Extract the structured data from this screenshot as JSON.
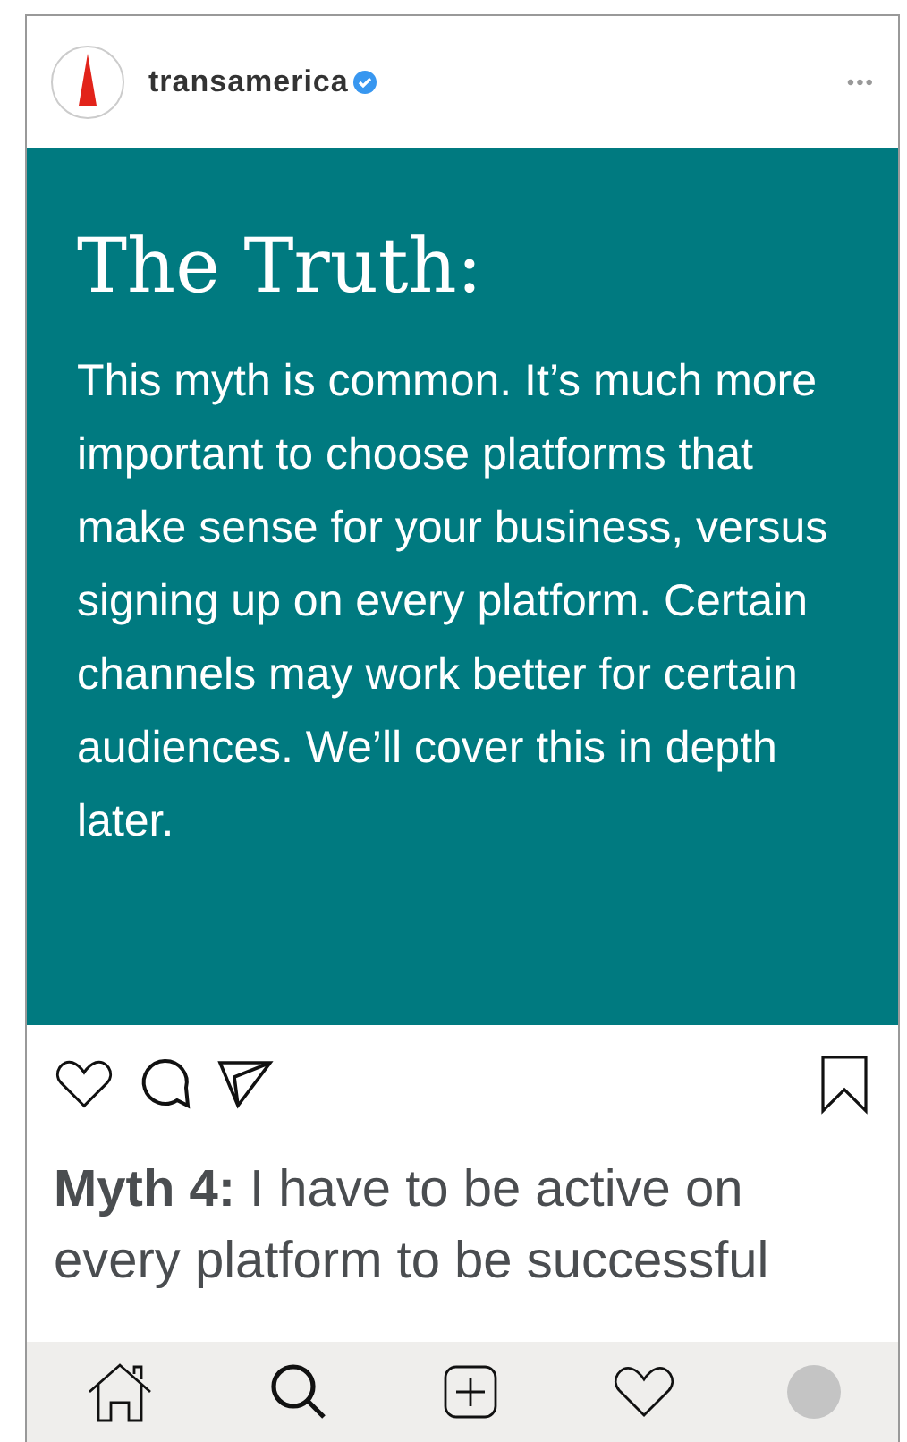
{
  "post": {
    "account": "transamerica",
    "verified": true,
    "more": "•••",
    "slide": {
      "title": "The Truth:",
      "body": "This myth is common. It’s much more important to choose platforms that make sense for your business, versus signing up on every platform. Certain channels may work better for certain audiences. We’ll cover this in depth later."
    },
    "actions": {
      "liked": false,
      "saved": false
    },
    "caption": "**Myth 4:** I have to be active on every platform to be successful"
  },
  "nav": [
    {
      "kind": "home",
      "selected": false
    },
    {
      "kind": "search",
      "selected": true
    },
    {
      "kind": "add",
      "selected": false
    },
    {
      "kind": "activity",
      "selected": false
    },
    {
      "kind": "profile",
      "selected": false
    }
  ]
}
